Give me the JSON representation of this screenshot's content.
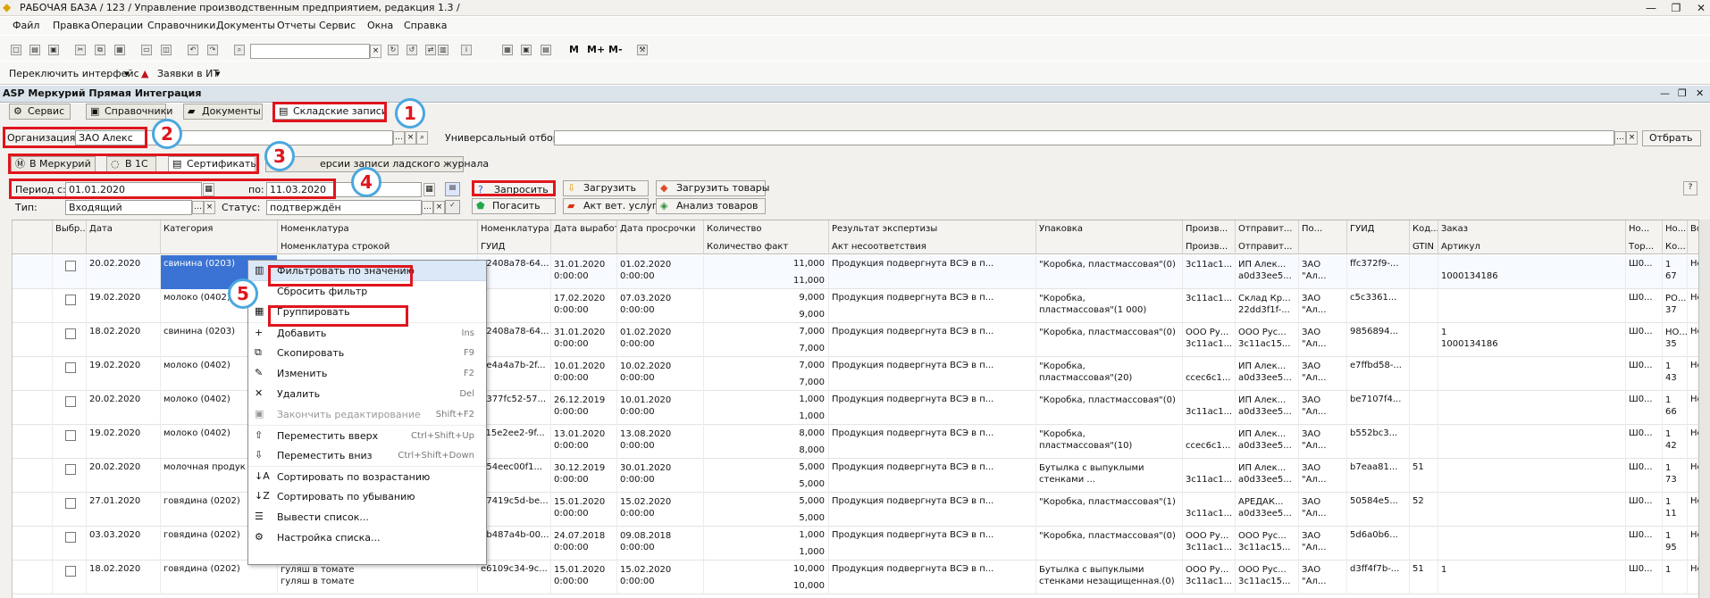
{
  "window": {
    "title": "РАБОЧАЯ БАЗА / 123 / Управление производственным предприятием, редакция 1.3 /"
  },
  "menu": [
    "Файл",
    "Правка",
    "Операции",
    "Справочники",
    "Документы",
    "Отчеты",
    "Сервис",
    "Окна",
    "Справка"
  ],
  "toolbar": {
    "switch_label": "Переключить интерфейс",
    "requests_label": "Заявки в ИТ"
  },
  "panel": {
    "title": "ASP Меркурий Прямая Интеграция"
  },
  "tabs": [
    "Сервис",
    "Справочники",
    "Документы",
    "Складские записи"
  ],
  "filters": {
    "organization_label": "Организация:",
    "organization_value": "ЗАО   Алекс",
    "universal_filter_label": "Универсальный отбор:",
    "select_button": "Отбрать",
    "period_label": "Период с:",
    "date_from": "01.01.2020",
    "to_label": "по:",
    "date_to": "11.03.2020",
    "type_label": "Тип:",
    "type_value": "Входящий",
    "status_label": "Статус:",
    "status_value": "подтверждён"
  },
  "subtabs": [
    "В Меркурий",
    "В 1С",
    "Сертификаты"
  ],
  "hidden_tab": "ерсии записи   ладского журнала",
  "buttons": {
    "request": "Запросить",
    "load": "Загрузить",
    "load_goods": "Загрузить товары",
    "repay": "Погасить",
    "vet_act": "Акт вет. услуг",
    "analysis": "Анализ товаров",
    "help": "?"
  },
  "annotations": [
    "1",
    "2",
    "3",
    "4",
    "5"
  ],
  "table": {
    "columns": [
      {
        "top": "",
        "bottom": ""
      },
      {
        "top": "Выбр...",
        "bottom": ""
      },
      {
        "top": "Дата",
        "bottom": ""
      },
      {
        "top": "Категория",
        "bottom": ""
      },
      {
        "top": "Номенклатура",
        "bottom": "Номенклатура строкой"
      },
      {
        "top": "Номенклатура",
        "bottom": "ГУИД"
      },
      {
        "top": "Дата выработки",
        "bottom": ""
      },
      {
        "top": "Дата просрочки",
        "bottom": ""
      },
      {
        "top": "Количество",
        "bottom": "Количество факт"
      },
      {
        "top": "Результат экспертизы",
        "bottom": "Акт несоответствия"
      },
      {
        "top": "Упаковка",
        "bottom": ""
      },
      {
        "top": "Произв...",
        "bottom": "Произв..."
      },
      {
        "top": "Отправит...",
        "bottom": "Отправит..."
      },
      {
        "top": "По...",
        "bottom": ""
      },
      {
        "top": "ГУИД",
        "bottom": ""
      },
      {
        "top": "Код...",
        "bottom": "GTIN"
      },
      {
        "top": "Заказ",
        "bottom": "Артикул"
      },
      {
        "top": "Но...",
        "bottom": "Тор..."
      },
      {
        "top": "Но...",
        "bottom": "Ко..."
      },
      {
        "top": "Во...",
        "bottom": ""
      }
    ],
    "rows": [
      {
        "date": "20.02.2020",
        "category": "свинина (0203)",
        "nom": "",
        "guid": "82408a78-64...",
        "prod": "31.01.2020\n0:00:00",
        "exp": "01.02.2020\n0:00:00",
        "qty": "11,000",
        "qty_fact": "11,000",
        "result": "Продукция подвергнута ВСЭ в п...",
        "pack": "\"Коробка, пластмассовая\"(0)",
        "prod_by": "3c11ac1...",
        "sender": "ИП Алек...\na0d33ee5...",
        "po": "ЗАО\n\"Ал...",
        "guid2": "ffc372f9-...",
        "code": "",
        "order": "\n1000134186",
        "no1": "Ш0...",
        "no2": "1\n67",
        "vo": "Нет"
      },
      {
        "date": "19.02.2020",
        "category": "молоко (0402)",
        "nom": "",
        "guid": "",
        "prod": "17.02.2020\n0:00:00",
        "exp": "07.03.2020\n0:00:00",
        "qty": "9,000",
        "qty_fact": "9,000",
        "result": "Продукция подвергнута ВСЭ в п...",
        "pack": "\"Коробка,\nпластмассовая\"(1 000)",
        "prod_by": "3c11ac1...",
        "sender": "Склад Кр...\n22dd3f1f-...",
        "po": "ЗАО\n\"Ал...",
        "guid2": "c5c3361...",
        "code": "",
        "order": "",
        "no1": "Ш0...",
        "no2": "РО...\n37",
        "vo": "Нет"
      },
      {
        "date": "18.02.2020",
        "category": "свинина (0203)",
        "nom": "",
        "guid": "82408a78-64...",
        "prod": "31.01.2020\n0:00:00",
        "exp": "01.02.2020\n0:00:00",
        "qty": "7,000",
        "qty_fact": "7,000",
        "result": "Продукция подвергнута ВСЭ в п...",
        "pack": "\"Коробка, пластмассовая\"(0)",
        "prod_by": "ООО Ру...\n3c11ac1...",
        "sender": "ООО Рус...\n3c11ac15...",
        "po": "ЗАО\n\"Ал...",
        "guid2": "9856894...",
        "code": "",
        "order": "1\n1000134186",
        "no1": "Ш0...",
        "no2": "НО...\n35",
        "vo": "Нет"
      },
      {
        "date": "19.02.2020",
        "category": "молоко (0402)",
        "nom": "",
        "guid": "9e4a4a7b-2f...",
        "prod": "10.01.2020\n0:00:00",
        "exp": "10.02.2020\n0:00:00",
        "qty": "7,000",
        "qty_fact": "7,000",
        "result": "Продукция подвергнута ВСЭ в п...",
        "pack": "\"Коробка,\nпластмассовая\"(20)",
        "prod_by": "\nccec6c1...",
        "sender": "ИП Алек...\na0d33ee5...",
        "po": "ЗАО\n\"Ал...",
        "guid2": "e7ffbd58-...",
        "code": "",
        "order": "",
        "no1": "Ш0...",
        "no2": "1\n43",
        "vo": "Нет"
      },
      {
        "date": "20.02.2020",
        "category": "молоко (0402)",
        "nom": "",
        "guid": "6377fc52-57...",
        "prod": "26.12.2019\n0:00:00",
        "exp": "10.01.2020\n0:00:00",
        "qty": "1,000",
        "qty_fact": "1,000",
        "result": "Продукция подвергнута ВСЭ в п...",
        "pack": "\"Коробка, пластмассовая\"(0)",
        "prod_by": "\n3c11ac1...",
        "sender": "ИП Алек...\na0d33ee5...",
        "po": "ЗАО\n\"Ал...",
        "guid2": "be7107f4...",
        "code": "",
        "order": "",
        "no1": "Ш0...",
        "no2": "1\n66",
        "vo": "Нет"
      },
      {
        "date": "19.02.2020",
        "category": "молоко (0402)",
        "nom": "",
        "guid": "c15e2ee2-9f...",
        "prod": "13.01.2020\n0:00:00",
        "exp": "13.08.2020\n0:00:00",
        "qty": "8,000",
        "qty_fact": "8,000",
        "result": "Продукция подвергнута ВСЭ в п...",
        "pack": "\"Коробка,\nпластмассовая\"(10)",
        "prod_by": "\nccec6c1...",
        "sender": "ИП Алек...\na0d33ee5...",
        "po": "ЗАО\n\"Ал...",
        "guid2": "b552bc3...",
        "code": "",
        "order": "",
        "no1": "Ш0...",
        "no2": "1\n42",
        "vo": "Нет"
      },
      {
        "date": "20.02.2020",
        "category": "молочная продук",
        "nom": "",
        "guid": "054eec00f1...",
        "prod": "30.12.2019\n0:00:00",
        "exp": "30.01.2020\n0:00:00",
        "qty": "5,000",
        "qty_fact": "5,000",
        "result": "Продукция подвергнута ВСЭ в п...",
        "pack": "Бутылка с выпуклыми\nстенками ...",
        "prod_by": "\n3c11ac1...",
        "sender": "ИП Алек...\na0d33ee5...",
        "po": "ЗАО\n\"Ал...",
        "guid2": "b7eaa81...",
        "code": "51",
        "order": "",
        "no1": "Ш0...",
        "no2": "1\n73",
        "vo": "Нет"
      },
      {
        "date": "27.01.2020",
        "category": "говядина (0202)",
        "nom": "",
        "guid": "67419c5d-be...",
        "prod": "15.01.2020\n0:00:00",
        "exp": "15.02.2020\n0:00:00",
        "qty": "5,000",
        "qty_fact": "5,000",
        "result": "Продукция подвергнута ВСЭ в п...",
        "pack": "\"Коробка, пластмассовая\"(1)",
        "prod_by": "\n3c11ac1...",
        "sender": "АРЕДАК...\na0d33ee5...",
        "po": "ЗАО\n\"Ал...",
        "guid2": "50584e5...",
        "code": "52",
        "order": "",
        "no1": "Ш0...",
        "no2": "1\n11",
        "vo": "Нет"
      },
      {
        "date": "03.03.2020",
        "category": "говядина (0202)",
        "nom": "",
        "guid": "2b487a4b-00...",
        "prod": "24.07.2018\n0:00:00",
        "exp": "09.08.2018\n0:00:00",
        "qty": "1,000",
        "qty_fact": "1,000",
        "result": "Продукция подвергнута ВСЭ в п...",
        "pack": "\"Коробка, пластмассовая\"(0)",
        "prod_by": "ООО Ру...\n3c11ac1...",
        "sender": "ООО Рус...\n3c11ac15...",
        "po": "ЗАО\n\"Ал...",
        "guid2": "5d6a0b6...",
        "code": "",
        "order": "",
        "no1": "Ш0...",
        "no2": "1\n95",
        "vo": "Нет"
      },
      {
        "date": "18.02.2020",
        "category": "говядина (0202)",
        "nom": "гуляш в томате\nгуляш в томате",
        "guid": "e6109c34-9c...",
        "prod": "15.01.2020\n0:00:00",
        "exp": "15.02.2020\n0:00:00",
        "qty": "10,000",
        "qty_fact": "10,000",
        "result": "Продукция подвергнута ВСЭ в п...",
        "pack": "Бутылка с выпуклыми\nстенками незащищенная.(0)",
        "prod_by": "ООО Ру...\n3c11ac1...",
        "sender": "ООО Рус...\n3c11ac15...",
        "po": "ЗАО\n\"Ал...",
        "guid2": "d3ff4f7b-...",
        "code": "51",
        "order": "1",
        "no1": "Ш0...",
        "no2": "1\n",
        "vo": "Нет"
      }
    ]
  },
  "context_menu": [
    {
      "label": "Фильтровать по значению",
      "key": "",
      "icon": "filter-icon",
      "disabled": false
    },
    {
      "label": "Сбросить фильтр",
      "key": "",
      "icon": "",
      "disabled": false
    },
    {
      "label": "Группировать",
      "key": "",
      "icon": "group-icon",
      "disabled": false
    },
    {
      "label": "Добавить",
      "key": "Ins",
      "icon": "plus-icon",
      "disabled": false
    },
    {
      "label": "Скопировать",
      "key": "F9",
      "icon": "copy-icon",
      "disabled": false
    },
    {
      "label": "Изменить",
      "key": "F2",
      "icon": "pencil-icon",
      "disabled": false
    },
    {
      "label": "Удалить",
      "key": "Del",
      "icon": "delete-icon",
      "disabled": false
    },
    {
      "label": "Закончить редактирование",
      "key": "Shift+F2",
      "icon": "finish-icon",
      "disabled": true
    },
    {
      "label": "Переместить вверх",
      "key": "Ctrl+Shift+Up",
      "icon": "arrow-up-icon",
      "disabled": false
    },
    {
      "label": "Переместить вниз",
      "key": "Ctrl+Shift+Down",
      "icon": "arrow-down-icon",
      "disabled": false
    },
    {
      "label": "Сортировать по возрастанию",
      "key": "",
      "icon": "sort-asc-icon",
      "disabled": false
    },
    {
      "label": "Сортировать по убыванию",
      "key": "",
      "icon": "sort-desc-icon",
      "disabled": false
    },
    {
      "label": "Вывести список...",
      "key": "",
      "icon": "list-icon",
      "disabled": false
    },
    {
      "label": "Настройка списка...",
      "key": "",
      "icon": "settings-icon",
      "disabled": false
    }
  ],
  "colors": {
    "highlight": "#e0151d",
    "badge_border": "#4ba7df",
    "selected_row": "#dbe8f8"
  }
}
